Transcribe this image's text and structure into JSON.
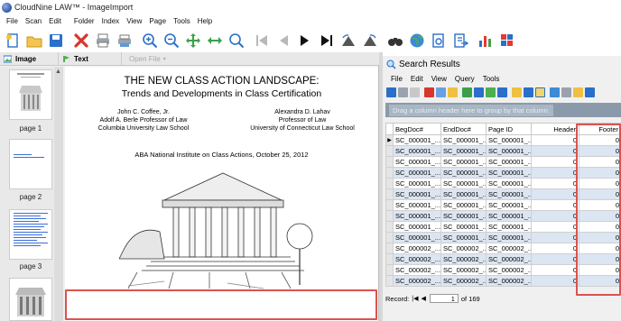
{
  "window": {
    "title": "CloudNine LAW™  - ImageImport"
  },
  "menu": [
    "File",
    "Scan",
    "Edit",
    "Folder",
    "Index",
    "View",
    "Page",
    "Tools",
    "Help"
  ],
  "toolbar_icons": [
    "new-icon",
    "open-folder-icon",
    "save-icon",
    "delete-icon",
    "print-icon",
    "print-setup-icon",
    "zoom-in-icon",
    "zoom-out-icon",
    "pan-icon",
    "fit-width-icon",
    "zoom-icon",
    "first-page-icon",
    "previous-page-icon",
    "next-page-icon",
    "last-page-icon",
    "rotate-left-icon",
    "rotate-right-icon",
    "binoculars-icon",
    "globe-icon",
    "export-icon",
    "open-document-icon",
    "bar-chart-icon",
    "puzzle-icon"
  ],
  "left_tabs": {
    "image": "Image",
    "text": "Text",
    "open_file": "Open File"
  },
  "thumbnails": [
    {
      "label": "page 1"
    },
    {
      "label": "page 2"
    },
    {
      "label": "page 3"
    }
  ],
  "document": {
    "title": "THE NEW CLASS ACTION LANDSCAPE:",
    "subtitle": "Trends and Developments in Class Certification",
    "author_left": [
      "John C. Coffee, Jr.",
      "Adolf A. Berle Professor of Law",
      "Columbia University Law School"
    ],
    "author_right": [
      "Alexandra D. Lahav",
      "Professor of Law",
      "University of Connecticut Law School"
    ],
    "event": "ABA National Institute on Class Actions, October 25, 2012"
  },
  "search_results": {
    "title": "Search Results",
    "menu": [
      "File",
      "Edit",
      "View",
      "Query",
      "Tools"
    ],
    "group_hint": "Drag a column header here to group by that column.",
    "columns": [
      "BegDoc#",
      "EndDoc#",
      "Page ID",
      "Header",
      "Footer"
    ],
    "rows": [
      [
        "SC_000001_...",
        "SC_000001_...",
        "SC_000001_...",
        "0",
        "0"
      ],
      [
        "SC_000001_...",
        "SC_000001_...",
        "SC_000001_...",
        "0",
        "0"
      ],
      [
        "SC_000001_...",
        "SC_000001_...",
        "SC_000001_...",
        "0",
        "0"
      ],
      [
        "SC_000001_...",
        "SC_000001_...",
        "SC_000001_...",
        "0",
        "0"
      ],
      [
        "SC_000001_...",
        "SC_000001_...",
        "SC_000001_...",
        "0",
        "0"
      ],
      [
        "SC_000001_...",
        "SC_000001_...",
        "SC_000001_...",
        "0",
        "0"
      ],
      [
        "SC_000001_...",
        "SC_000001_...",
        "SC_000001_...",
        "0",
        "0"
      ],
      [
        "SC_000001_...",
        "SC_000001_...",
        "SC_000001_...",
        "0",
        "0"
      ],
      [
        "SC_000001_...",
        "SC_000001_...",
        "SC_000001_...",
        "0",
        "0"
      ],
      [
        "SC_000001_...",
        "SC_000001_...",
        "SC_000001_...",
        "0",
        "0"
      ],
      [
        "SC_000002_...",
        "SC_000002_...",
        "SC_000002_...",
        "0",
        "0"
      ],
      [
        "SC_000002_...",
        "SC_000002_...",
        "SC_000002_...",
        "0",
        "0"
      ],
      [
        "SC_000002_...",
        "SC_000002_...",
        "SC_000002_...",
        "0",
        "0"
      ],
      [
        "SC_000002_...",
        "SC_000002_...",
        "SC_000002_...",
        "0",
        "0"
      ]
    ],
    "record": {
      "label": "Record:",
      "current": "1",
      "of": "of 169"
    }
  },
  "colors": {
    "highlight": "#d9534f",
    "row_alt": "#dce6f2",
    "group_bar": "#8a9aaa"
  }
}
